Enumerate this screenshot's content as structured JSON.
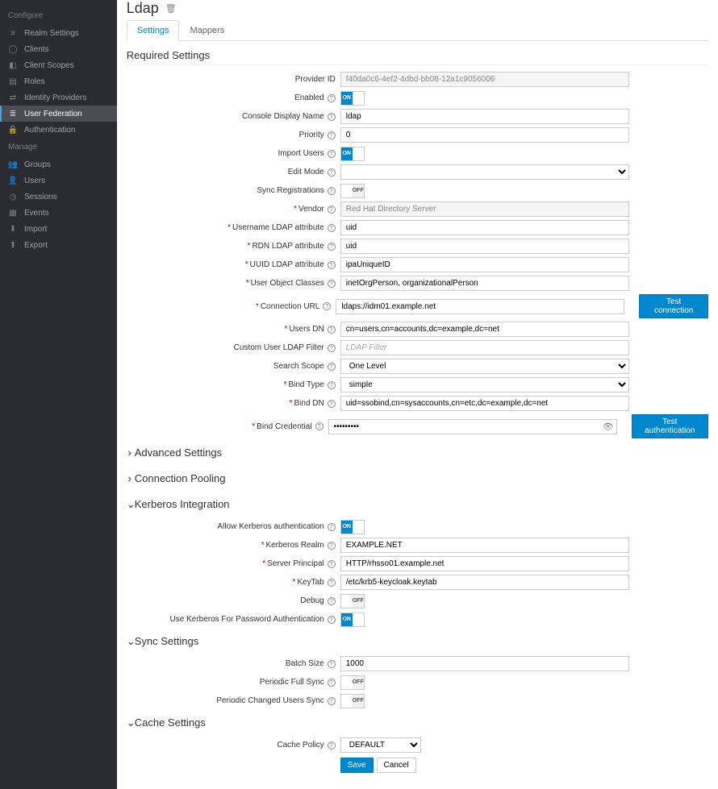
{
  "sidebar": {
    "configure_label": "Configure",
    "manage_label": "Manage",
    "configure_items": [
      {
        "label": "Realm Settings"
      },
      {
        "label": "Clients"
      },
      {
        "label": "Client Scopes"
      },
      {
        "label": "Roles"
      },
      {
        "label": "Identity Providers"
      },
      {
        "label": "User Federation"
      },
      {
        "label": "Authentication"
      }
    ],
    "manage_items": [
      {
        "label": "Groups"
      },
      {
        "label": "Users"
      },
      {
        "label": "Sessions"
      },
      {
        "label": "Events"
      },
      {
        "label": "Import"
      },
      {
        "label": "Export"
      }
    ]
  },
  "page": {
    "title": "Ldap",
    "tabs": {
      "settings": "Settings",
      "mappers": "Mappers"
    }
  },
  "sections": {
    "required": "Required Settings",
    "advanced": "Advanced Settings",
    "pooling": "Connection Pooling",
    "kerberos": "Kerberos Integration",
    "sync": "Sync Settings",
    "cache": "Cache Settings"
  },
  "labels": {
    "provider_id": "Provider ID",
    "enabled": "Enabled",
    "console_display_name": "Console Display Name",
    "priority": "Priority",
    "import_users": "Import Users",
    "edit_mode": "Edit Mode",
    "sync_registrations": "Sync Registrations",
    "vendor": "Vendor",
    "username_ldap_attr": "Username LDAP attribute",
    "rdn_ldap_attr": "RDN LDAP attribute",
    "uuid_ldap_attr": "UUID LDAP attribute",
    "user_object_classes": "User Object Classes",
    "connection_url": "Connection URL",
    "users_dn": "Users DN",
    "custom_user_ldap_filter": "Custom User LDAP Filter",
    "search_scope": "Search Scope",
    "bind_type": "Bind Type",
    "bind_dn": "Bind DN",
    "bind_credential": "Bind Credential",
    "allow_kerberos_auth": "Allow Kerberos authentication",
    "kerberos_realm": "Kerberos Realm",
    "server_principal": "Server Principal",
    "keytab": "KeyTab",
    "debug": "Debug",
    "use_kerberos_for_pw": "Use Kerberos For Password Authentication",
    "batch_size": "Batch Size",
    "periodic_full_sync": "Periodic Full Sync",
    "periodic_changed_sync": "Periodic Changed Users Sync",
    "cache_policy": "Cache Policy"
  },
  "values": {
    "provider_id": "f40da0c6-4ef2-4dbd-bb08-12a1c9056006",
    "console_display_name": "ldap",
    "priority": "0",
    "edit_mode": "",
    "vendor": "Red Hat Directory Server",
    "username_ldap_attr": "uid",
    "rdn_ldap_attr": "uid",
    "uuid_ldap_attr": "ipaUniqueID",
    "user_object_classes": "inetOrgPerson, organizationalPerson",
    "connection_url": "ldaps://idm01.example.net",
    "users_dn": "cn=users,cn=accounts,dc=example,dc=net",
    "custom_user_ldap_filter_placeholder": "LDAP Filter",
    "search_scope": "One Level",
    "bind_type": "simple",
    "bind_dn": "uid=ssobind,cn=sysaccounts,cn=etc,dc=example,dc=net",
    "bind_credential": "•••••••••",
    "kerberos_realm": "EXAMPLE.NET",
    "server_principal": "HTTP/rhsso01.example.net",
    "keytab": "/etc/krb5-keycloak.keytab",
    "batch_size": "1000",
    "cache_policy": "DEFAULT"
  },
  "toggles": {
    "enabled": "ON",
    "import_users": "ON",
    "sync_registrations": "OFF",
    "allow_kerberos_auth": "ON",
    "debug": "OFF",
    "use_kerberos_for_pw": "ON",
    "periodic_full_sync": "OFF",
    "periodic_changed_sync": "OFF"
  },
  "buttons": {
    "test_connection": "Test connection",
    "test_authentication": "Test authentication",
    "save": "Save",
    "cancel": "Cancel"
  },
  "toggle_words": {
    "on": "ON",
    "off": "OFF"
  }
}
